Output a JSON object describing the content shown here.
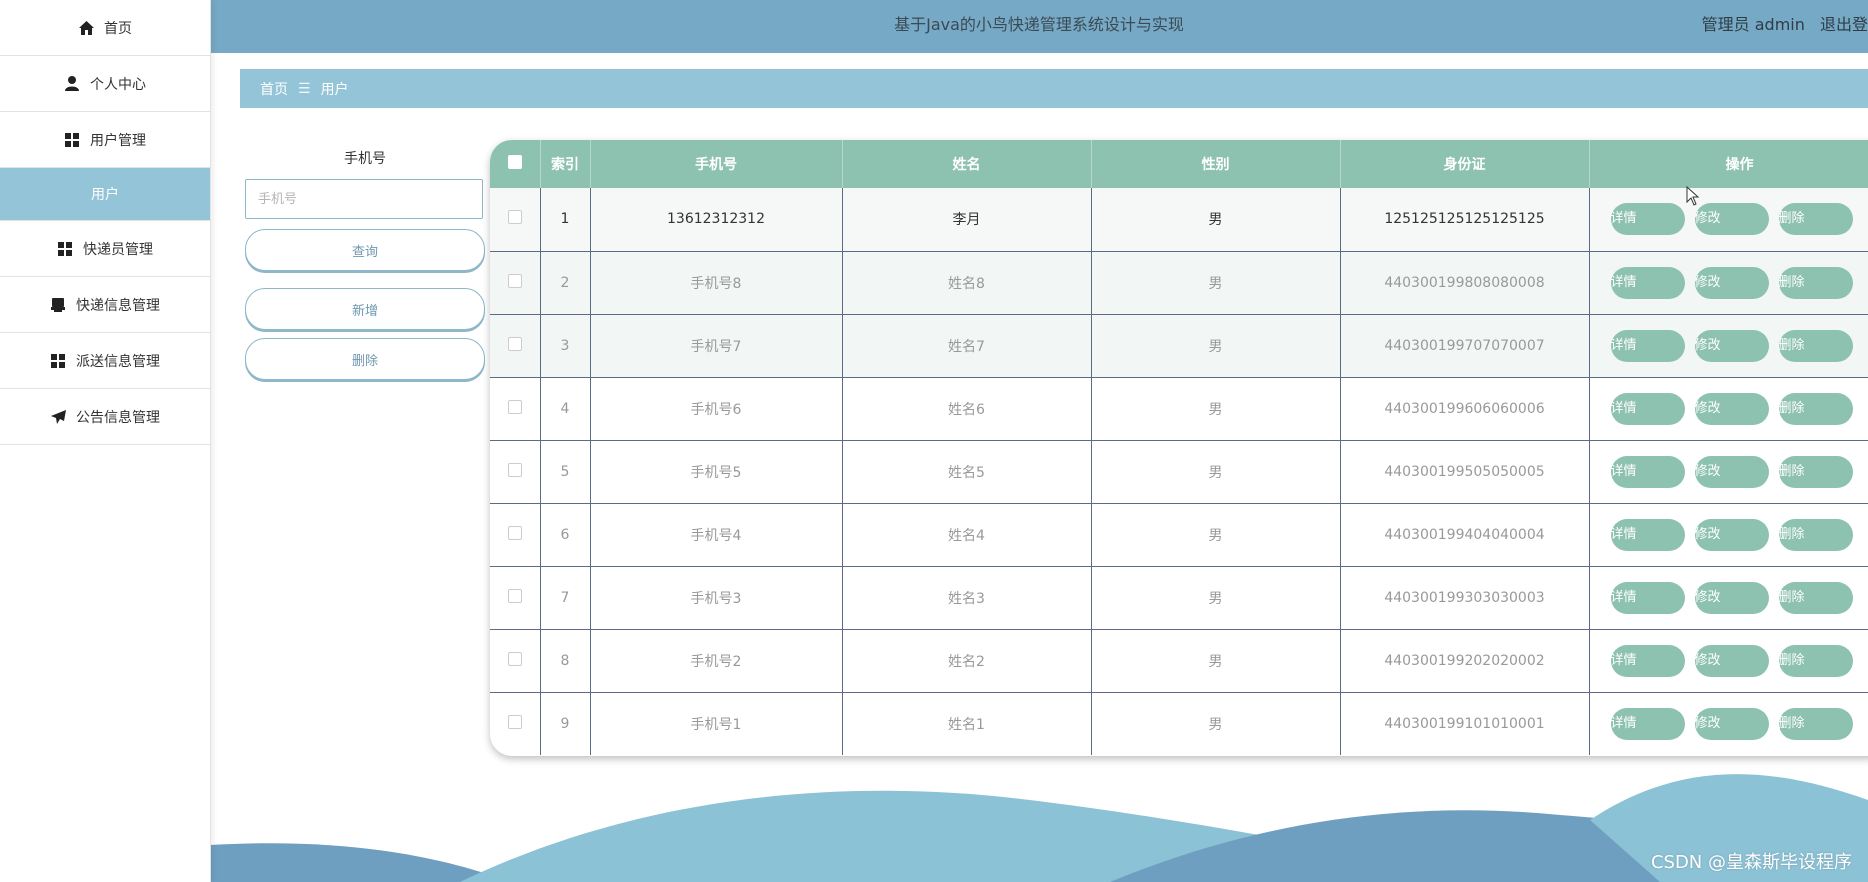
{
  "sidebar": {
    "items": [
      {
        "label": "首页",
        "icon": "home-icon"
      },
      {
        "label": "个人中心",
        "icon": "user-icon"
      },
      {
        "label": "用户管理",
        "icon": "grid-icon"
      },
      {
        "label": "用户",
        "sub": true
      },
      {
        "label": "快递员管理",
        "icon": "grid-icon"
      },
      {
        "label": "快递信息管理",
        "icon": "printer-icon"
      },
      {
        "label": "派送信息管理",
        "icon": "grid-icon"
      },
      {
        "label": "公告信息管理",
        "icon": "send-icon"
      }
    ]
  },
  "header": {
    "title": "基于Java的小鸟快递管理系统设计与实现",
    "admin_label": "管理员 admin",
    "logout_label": "退出登"
  },
  "breadcrumb": {
    "home": "首页",
    "separator": "☰",
    "current": "用户"
  },
  "search": {
    "label": "手机号",
    "placeholder": "手机号",
    "query_button": "查询",
    "add_button": "新增",
    "delete_button": "删除"
  },
  "table": {
    "columns": [
      "索引",
      "手机号",
      "姓名",
      "性别",
      "身份证",
      "操作"
    ],
    "rows": [
      {
        "index": "1",
        "phone": "13612312312",
        "name": "李月",
        "gender": "男",
        "id_card": "125125125125125125"
      },
      {
        "index": "2",
        "phone": "手机号8",
        "name": "姓名8",
        "gender": "男",
        "id_card": "440300199808080008"
      },
      {
        "index": "3",
        "phone": "手机号7",
        "name": "姓名7",
        "gender": "男",
        "id_card": "440300199707070007"
      },
      {
        "index": "4",
        "phone": "手机号6",
        "name": "姓名6",
        "gender": "男",
        "id_card": "440300199606060006"
      },
      {
        "index": "5",
        "phone": "手机号5",
        "name": "姓名5",
        "gender": "男",
        "id_card": "440300199505050005"
      },
      {
        "index": "6",
        "phone": "手机号4",
        "name": "姓名4",
        "gender": "男",
        "id_card": "440300199404040004"
      },
      {
        "index": "7",
        "phone": "手机号3",
        "name": "姓名3",
        "gender": "男",
        "id_card": "440300199303030003"
      },
      {
        "index": "8",
        "phone": "手机号2",
        "name": "姓名2",
        "gender": "男",
        "id_card": "440300199202020002"
      },
      {
        "index": "9",
        "phone": "手机号1",
        "name": "姓名1",
        "gender": "男",
        "id_card": "440300199101010001"
      }
    ],
    "actions": {
      "detail": "详情",
      "edit": "修改",
      "delete": "删除"
    }
  },
  "watermark": "CSDN @皇森斯毕设程序",
  "colors": {
    "header": "#76a9c5",
    "breadcrumb": "#94c4d8",
    "table_header": "#8ec2b0",
    "action_button": "#8ec2b0"
  }
}
